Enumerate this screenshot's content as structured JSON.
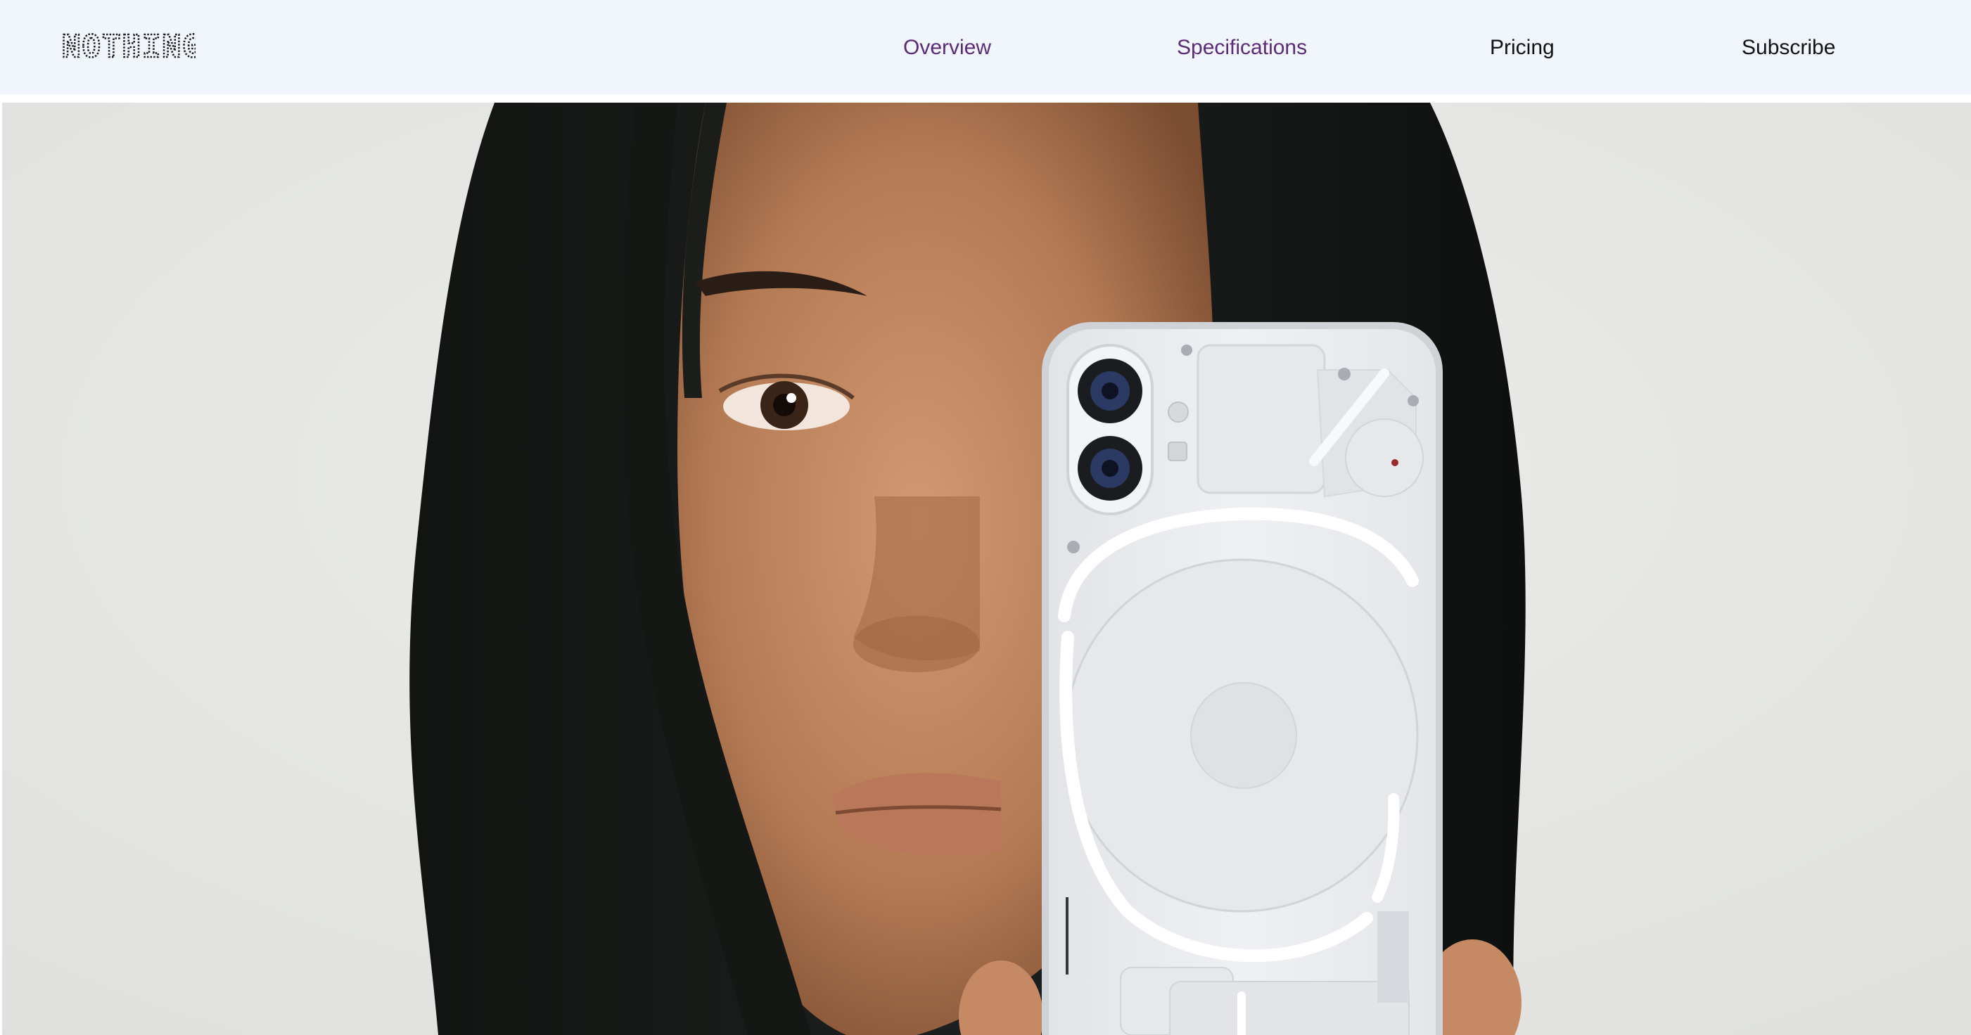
{
  "header": {
    "logo_text": "NOTHING",
    "nav": {
      "overview_label": "Overview",
      "specifications_label": "Specifications",
      "pricing_label": "Pricing",
      "subscribe_label": "Subscribe"
    }
  },
  "hero": {
    "image_subject": "person holding white transparent smartphone",
    "background_color": "#e6e7e5"
  },
  "colors": {
    "header_bg": "#f1f6fd",
    "visited_link": "#5b2b78",
    "link": "#121212"
  }
}
